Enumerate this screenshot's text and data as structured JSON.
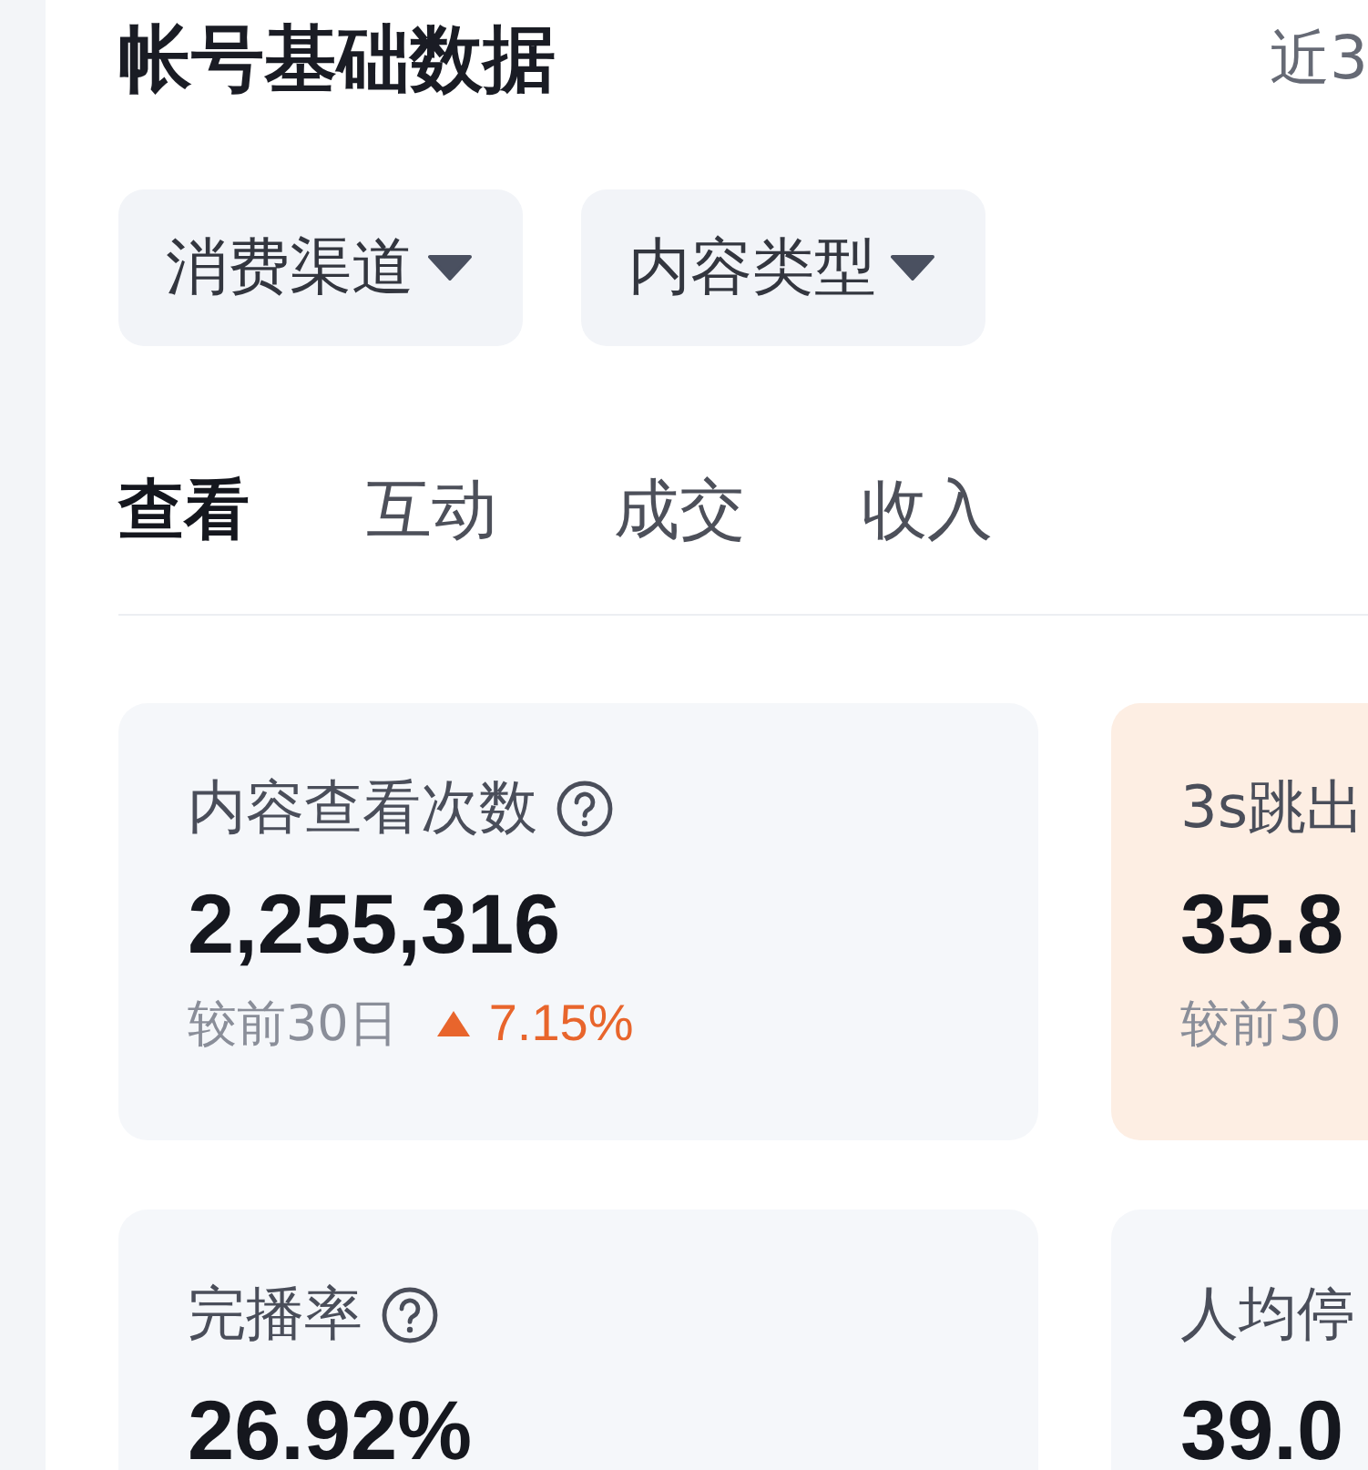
{
  "header": {
    "title": "帐号基础数据",
    "range": "近3"
  },
  "filters": [
    {
      "label": "消费渠道"
    },
    {
      "label": "内容类型"
    }
  ],
  "tabs": [
    {
      "label": "查看",
      "selected": true
    },
    {
      "label": "互动",
      "selected": false
    },
    {
      "label": "成交",
      "selected": false
    },
    {
      "label": "收入",
      "selected": false
    }
  ],
  "cards": [
    {
      "title": "内容查看次数",
      "help": true,
      "value": "2,255,316",
      "compare": "较前30日",
      "rising": true,
      "change": "7.15%",
      "highlighted": false
    },
    {
      "title": "3s跳出",
      "value": "35.8",
      "compare": "较前30",
      "highlighted": true
    },
    {
      "title": "完播率",
      "help": true,
      "value": "26.92%",
      "highlighted": false
    },
    {
      "title": "人均停",
      "value": "39.0",
      "highlighted": false
    }
  ]
}
